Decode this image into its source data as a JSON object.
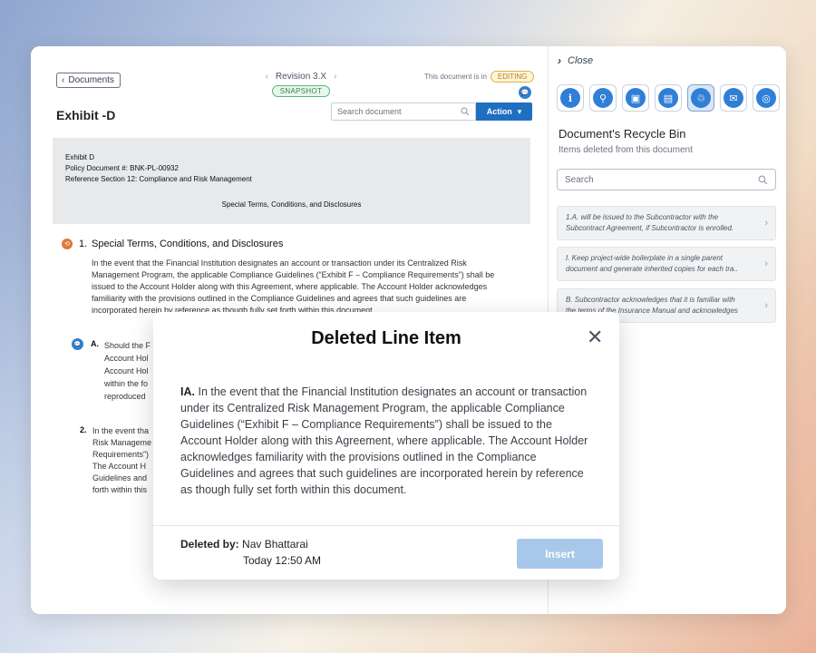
{
  "toolbar": {
    "back_label": "Documents",
    "revision_label": "Revision 3.X",
    "snapshot_badge": "SNAPSHOT",
    "status_prefix": "This document is in",
    "status_badge": "EDITING",
    "search_placeholder": "Search document",
    "action_label": "Action"
  },
  "document": {
    "title": "Exhibit -D",
    "header_lines": [
      "Exhibit D",
      "Policy Document #: BNK-PL-00932",
      "Reference Section 12: Compliance and Risk Management"
    ],
    "header_center": "Special Terms, Conditions, and Disclosures",
    "section1": {
      "number": "1.",
      "title": "Special Terms, Conditions, and Disclosures",
      "body": "In the event that the Financial Institution designates an account or transaction under its Centralized Risk Management Program, the applicable Compliance Guidelines (“Exhibit F – Compliance Requirements”) shall be issued to the Account Holder along with this Agreement, where applicable. The Account Holder acknowledges familiarity with the provisions outlined in the Compliance Guidelines and agrees that such guidelines are incorporated herein by reference as though fully set forth within this document."
    },
    "subA": {
      "label": "A.",
      "lines": [
        "Should the F",
        "Account Hol",
        "Account Hol",
        "within the fo",
        "reproduced"
      ]
    },
    "section2": {
      "number": "2.",
      "lines": [
        "In the event tha",
        "Risk Manageme",
        "Requirements”)",
        "The Account H",
        "Guidelines and",
        "forth within this"
      ]
    }
  },
  "side_panel": {
    "close_label": "Close",
    "tools": [
      {
        "icon": "info-icon",
        "glyph": "i"
      },
      {
        "icon": "key-search-icon",
        "glyph": "⚲"
      },
      {
        "icon": "contact-card-icon",
        "glyph": "▣"
      },
      {
        "icon": "clipboard-icon",
        "glyph": "▤"
      },
      {
        "icon": "recycle-bin-icon",
        "glyph": "♲"
      },
      {
        "icon": "chat-icon",
        "glyph": "✉"
      },
      {
        "icon": "compass-icon",
        "glyph": "◎"
      }
    ],
    "active_tool": "recycle-bin-icon",
    "title": "Document's Recycle Bin",
    "subtitle": "Items deleted from this document",
    "search_placeholder": "Search",
    "items": [
      {
        "line1": "1.A. will be issued to the Subcontractor with the",
        "line2": "Subcontract Agreement, if Subcontractor is enrolled."
      },
      {
        "line1": "I. Keep project-wide boilerplate in a single parent",
        "line2": "document and generate inherited copies for each tra.."
      },
      {
        "line1": "B. Subcontractor acknowledges that it is familiar with",
        "line2": "the terms of the Insurance Manual and acknowledges"
      }
    ]
  },
  "modal": {
    "title": "Deleted Line Item",
    "prefix": "IA.",
    "body": "In the event that the Financial Institution designates an account or transaction under its Centralized Risk Management Program, the applicable Compliance Guidelines (“Exhibit F – Compliance Requirements”) shall be issued to the Account Holder along with this Agreement, where applicable. The Account Holder acknowledges familiarity with the provisions outlined in the Compliance Guidelines and agrees that such guidelines are incorporated herein by reference as though fully set forth within this document.",
    "deleted_by_label": "Deleted by:",
    "deleted_by_name": "Nav Bhattarai",
    "deleted_time": "Today 12:50 AM",
    "insert_label": "Insert"
  },
  "colors": {
    "accent": "#1f6fc1",
    "editing": "#e2b14a",
    "snapshot": "#5fb37c",
    "insert_disabled": "#a7c8e9"
  }
}
